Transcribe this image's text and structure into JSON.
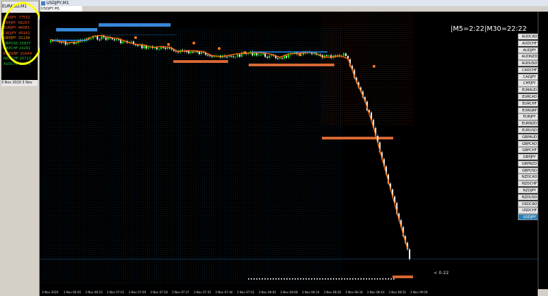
{
  "mini_window": {
    "title": "EURAUD,M1",
    "axis_text": "3 Nov 2020   3 Nov",
    "pairs": [
      {
        "label": "USDJPY -77532",
        "color": "#ff5a1e"
      },
      {
        "label": "CHFJPY -56257",
        "color": "#ff5a1e"
      },
      {
        "label": "EURJPY -46061",
        "color": "#ff5a1e"
      },
      {
        "label": "CADJPY -45161",
        "color": "#ff5a1e"
      },
      {
        "label": "GBPJPY -31139",
        "color": "#ff8c00"
      },
      {
        "label": "GBPUSD 25837",
        "color": "#27c93f"
      },
      {
        "label": "GBPCHF 24291",
        "color": "#27c93f"
      },
      {
        "label": "EURGBP -21644",
        "color": "#ff5a1e"
      },
      {
        "label": "NZDCHF 20713",
        "color": "#27c93f"
      },
      {
        "label": "AUDCHF 20671",
        "color": "#27c93f"
      }
    ]
  },
  "main_window": {
    "window_title": "USDJPY,M1",
    "tab_label": "USDJPY,M1",
    "clock_text": "|M5=2:22|M30=22:22",
    "price_label": "< 0:22",
    "symbols": [
      "AUDCAD",
      "AUDCHF",
      "AUDJPY",
      "AUDNZD",
      "AUDUSD",
      "CADCHF",
      "CADJPY",
      "CHFJPY",
      "EURAUD",
      "EURCAD",
      "EURCHF",
      "EURGBP",
      "EURJPY",
      "EURNZD",
      "EURUSD",
      "GBPAUD",
      "GBPCAD",
      "GBPCHF",
      "GBPJPY",
      "GBPNZD",
      "GBPUSD",
      "NZDCAD",
      "NZDCHF",
      "NZDJPY",
      "NZDUSD",
      "USDCAD",
      "USDCHF",
      "USDJPY"
    ],
    "active_symbol": "USDJPY",
    "time_labels": [
      "3 Nov 2020",
      "3 Nov 06:45",
      "3 Nov 06:53",
      "3 Nov 07:01",
      "3 Nov 07:09",
      "3 Nov 07:18",
      "3 Nov 07:27",
      "3 Nov 07:35",
      "3 Nov 07:44",
      "3 Nov 07:52",
      "3 Nov 08:00",
      "3 Nov 08:08",
      "3 Nov 08:16",
      "3 Nov 08:26",
      "3 Nov 08:34",
      "3 Nov 08:44",
      "3 Nov 08:52",
      "3 Nov 09:00"
    ]
  },
  "colors": {
    "background": "#000000",
    "up_candle": "#00ff00",
    "down_candle": "#ffffff",
    "ma_orange": "#ff6a00",
    "ma_blue": "#1e90ff",
    "highlight": "#ffff00"
  }
}
